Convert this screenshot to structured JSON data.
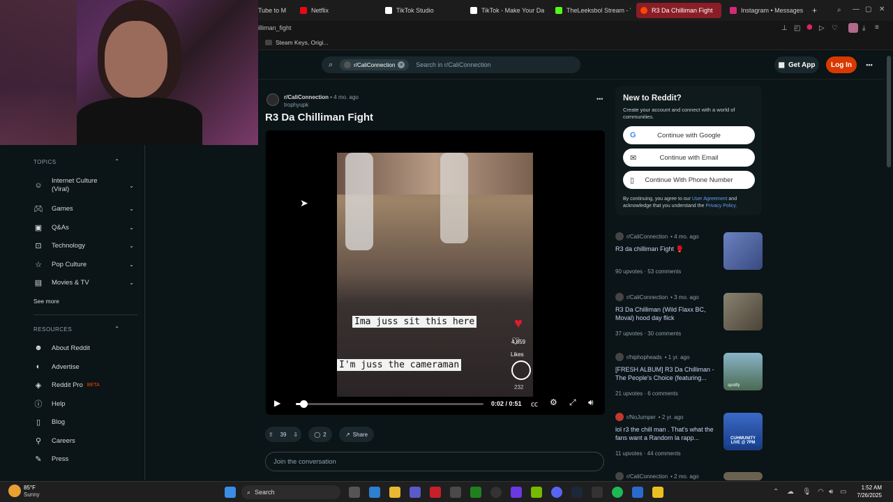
{
  "browser": {
    "tabs": [
      {
        "label": "Tube to M",
        "color": "#444444"
      },
      {
        "label": "Netflix",
        "color": "#e50914"
      },
      {
        "label": "TikTok Studio",
        "color": "#222222"
      },
      {
        "label": "TikTok - Make Your Day",
        "color": "#222222"
      },
      {
        "label": "TheLeeksbol Stream - V",
        "color": "#53fc18"
      },
      {
        "label": "R3 Da Chilliman Fight",
        "color": "#ff4500"
      },
      {
        "label": "Instagram • Messages",
        "color": "#d62976"
      }
    ],
    "new_tab": "+",
    "url": "illiman_fight",
    "bookmark": "Steam Keys, Origi..."
  },
  "header": {
    "community_chip": "r/CaliConnection",
    "search_placeholder": "Search in r/CaliConnection",
    "get_app": "Get App",
    "login": "Log In",
    "more": "•••"
  },
  "sidebar": {
    "topics_heading": "TOPICS",
    "topics": [
      {
        "label": "Internet Culture (Viral)",
        "icon": "smile-icon"
      },
      {
        "label": "Games",
        "icon": "gamepad-icon"
      },
      {
        "label": "Q&As",
        "icon": "qa-icon"
      },
      {
        "label": "Technology",
        "icon": "chip-icon"
      },
      {
        "label": "Pop Culture",
        "icon": "star-icon"
      },
      {
        "label": "Movies & TV",
        "icon": "clapper-icon"
      }
    ],
    "see_more": "See more",
    "resources_heading": "RESOURCES",
    "resources": [
      {
        "label": "About Reddit",
        "icon": "reddit-icon"
      },
      {
        "label": "Advertise",
        "icon": "megaphone-icon"
      },
      {
        "label": "Reddit Pro",
        "badge": "BETA",
        "icon": "pro-icon"
      },
      {
        "label": "Help",
        "icon": "help-icon"
      },
      {
        "label": "Blog",
        "icon": "book-icon"
      },
      {
        "label": "Careers",
        "icon": "careers-icon"
      },
      {
        "label": "Press",
        "icon": "press-icon"
      }
    ]
  },
  "post": {
    "subreddit": "r/CaliConnection",
    "age": "• 4 mo. ago",
    "author": "trophyupk",
    "title": "R3 Da Chilliman Fight",
    "options": "•••",
    "caption1": "Ima juss sit this here",
    "caption2": "I'm juss the cameraman",
    "likes_count": "4,859",
    "likes_label": "Likes",
    "comments_count": "232",
    "time": "0:02 / 0:51",
    "progress": 0.04,
    "upvotes": "39",
    "comments": "2",
    "share": "Share",
    "join_placeholder": "Join the conversation"
  },
  "new_to_reddit": {
    "title": "New to Reddit?",
    "subtitle": "Create your account and connect with a world of communities.",
    "google": "Continue with Google",
    "email": "Continue with Email",
    "phone": "Continue With Phone Number",
    "legal_prefix": "By continuing, you agree to our",
    "agreement": "User Agreement",
    "legal_mid": "and acknowledge that you understand the",
    "privacy": "Privacy Policy."
  },
  "related": [
    {
      "sub": "r/CaliConnection",
      "age": "• 4 mo. ago",
      "title": "R3 da chilliman Fight 🥊",
      "upvotes": "90 upvotes",
      "comments": "53 comments",
      "thumb": "#5a6fa0"
    },
    {
      "sub": "r/CaliConnection",
      "age": "• 3 mo. ago",
      "title": "R3 Da Chilliman (Wild Flaxx BC, Moval) hood day flick",
      "upvotes": "37 upvotes",
      "comments": "30 comments",
      "thumb": "#7a7466"
    },
    {
      "sub": "r/hiphopheads",
      "age": "• 1 yr. ago",
      "title": "[FRESH ALBUM] R3 Da Chilliman - The People's Choice (featuring...",
      "upvotes": "21 upvotes",
      "comments": "6 comments",
      "thumb": "#4f7a8c",
      "thumb_label": "spotify"
    },
    {
      "sub": "r/NoJumper",
      "age": "• 2 yr. ago",
      "title": "lol r3 the chill man . That's what the fans want a Random la rapp...",
      "upvotes": "11 upvotes",
      "comments": "44 comments",
      "thumb": "#2e5fb0",
      "thumb_label": "CUHMUNITY LIVE @ 7PM"
    },
    {
      "sub": "r/CaliConnection",
      "age": "• 2 mo. ago",
      "title": "",
      "upvotes": "",
      "comments": "",
      "thumb": "#6a6250"
    }
  ],
  "taskbar": {
    "weather_temp": "85°F",
    "weather_desc": "Sunny",
    "search": "Search",
    "time": "1:52 AM",
    "date": "7/26/2025"
  }
}
